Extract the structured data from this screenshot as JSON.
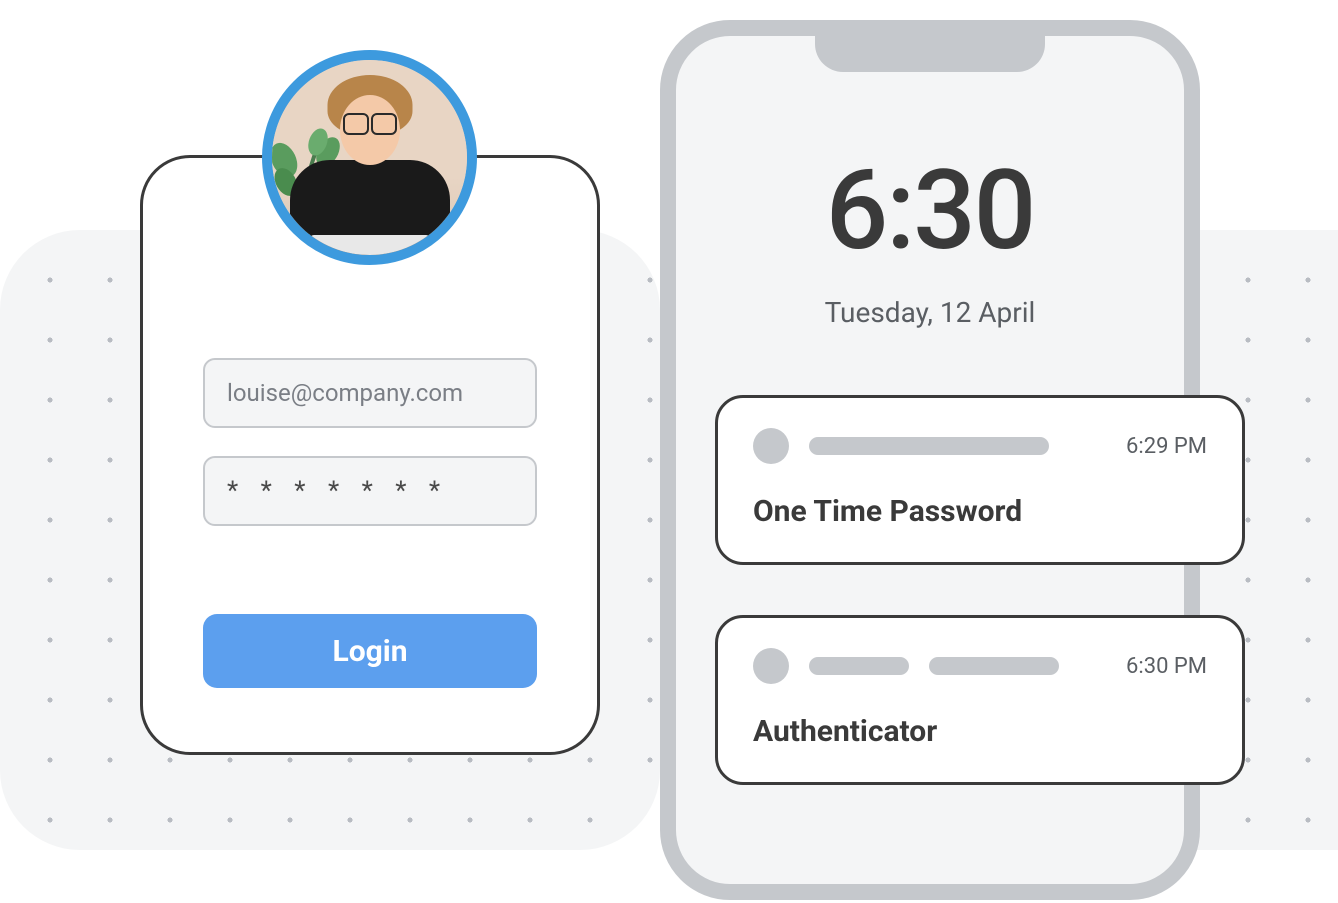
{
  "login": {
    "email_value": "louise@company.com",
    "password_value": "* * * * * * *",
    "button_label": "Login"
  },
  "phone": {
    "time": "6:30",
    "date": "Tuesday, 12 April"
  },
  "notifications": [
    {
      "title": "One Time Password",
      "time": "6:29 PM"
    },
    {
      "title": "Authenticator",
      "time": "6:30 PM"
    }
  ]
}
